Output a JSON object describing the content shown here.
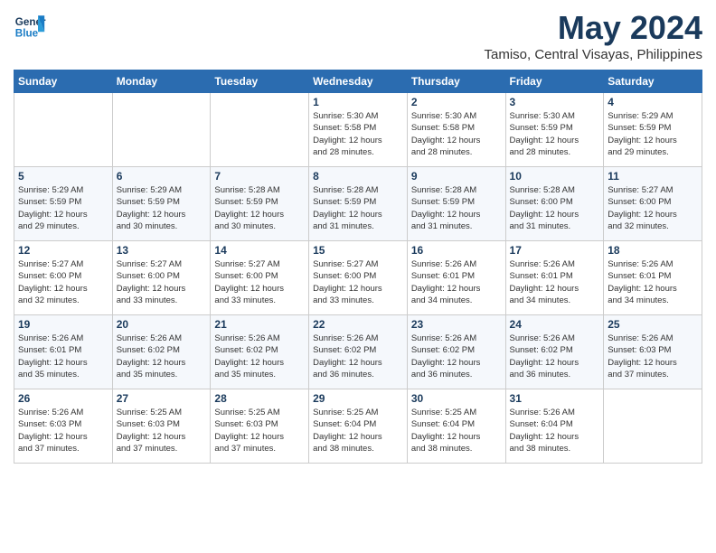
{
  "header": {
    "logo_line1": "General",
    "logo_line2": "Blue",
    "month_title": "May 2024",
    "location": "Tamiso, Central Visayas, Philippines"
  },
  "days_of_week": [
    "Sunday",
    "Monday",
    "Tuesday",
    "Wednesday",
    "Thursday",
    "Friday",
    "Saturday"
  ],
  "weeks": [
    [
      {
        "day": "",
        "info": ""
      },
      {
        "day": "",
        "info": ""
      },
      {
        "day": "",
        "info": ""
      },
      {
        "day": "1",
        "info": "Sunrise: 5:30 AM\nSunset: 5:58 PM\nDaylight: 12 hours\nand 28 minutes."
      },
      {
        "day": "2",
        "info": "Sunrise: 5:30 AM\nSunset: 5:58 PM\nDaylight: 12 hours\nand 28 minutes."
      },
      {
        "day": "3",
        "info": "Sunrise: 5:30 AM\nSunset: 5:59 PM\nDaylight: 12 hours\nand 28 minutes."
      },
      {
        "day": "4",
        "info": "Sunrise: 5:29 AM\nSunset: 5:59 PM\nDaylight: 12 hours\nand 29 minutes."
      }
    ],
    [
      {
        "day": "5",
        "info": "Sunrise: 5:29 AM\nSunset: 5:59 PM\nDaylight: 12 hours\nand 29 minutes."
      },
      {
        "day": "6",
        "info": "Sunrise: 5:29 AM\nSunset: 5:59 PM\nDaylight: 12 hours\nand 30 minutes."
      },
      {
        "day": "7",
        "info": "Sunrise: 5:28 AM\nSunset: 5:59 PM\nDaylight: 12 hours\nand 30 minutes."
      },
      {
        "day": "8",
        "info": "Sunrise: 5:28 AM\nSunset: 5:59 PM\nDaylight: 12 hours\nand 31 minutes."
      },
      {
        "day": "9",
        "info": "Sunrise: 5:28 AM\nSunset: 5:59 PM\nDaylight: 12 hours\nand 31 minutes."
      },
      {
        "day": "10",
        "info": "Sunrise: 5:28 AM\nSunset: 6:00 PM\nDaylight: 12 hours\nand 31 minutes."
      },
      {
        "day": "11",
        "info": "Sunrise: 5:27 AM\nSunset: 6:00 PM\nDaylight: 12 hours\nand 32 minutes."
      }
    ],
    [
      {
        "day": "12",
        "info": "Sunrise: 5:27 AM\nSunset: 6:00 PM\nDaylight: 12 hours\nand 32 minutes."
      },
      {
        "day": "13",
        "info": "Sunrise: 5:27 AM\nSunset: 6:00 PM\nDaylight: 12 hours\nand 33 minutes."
      },
      {
        "day": "14",
        "info": "Sunrise: 5:27 AM\nSunset: 6:00 PM\nDaylight: 12 hours\nand 33 minutes."
      },
      {
        "day": "15",
        "info": "Sunrise: 5:27 AM\nSunset: 6:00 PM\nDaylight: 12 hours\nand 33 minutes."
      },
      {
        "day": "16",
        "info": "Sunrise: 5:26 AM\nSunset: 6:01 PM\nDaylight: 12 hours\nand 34 minutes."
      },
      {
        "day": "17",
        "info": "Sunrise: 5:26 AM\nSunset: 6:01 PM\nDaylight: 12 hours\nand 34 minutes."
      },
      {
        "day": "18",
        "info": "Sunrise: 5:26 AM\nSunset: 6:01 PM\nDaylight: 12 hours\nand 34 minutes."
      }
    ],
    [
      {
        "day": "19",
        "info": "Sunrise: 5:26 AM\nSunset: 6:01 PM\nDaylight: 12 hours\nand 35 minutes."
      },
      {
        "day": "20",
        "info": "Sunrise: 5:26 AM\nSunset: 6:02 PM\nDaylight: 12 hours\nand 35 minutes."
      },
      {
        "day": "21",
        "info": "Sunrise: 5:26 AM\nSunset: 6:02 PM\nDaylight: 12 hours\nand 35 minutes."
      },
      {
        "day": "22",
        "info": "Sunrise: 5:26 AM\nSunset: 6:02 PM\nDaylight: 12 hours\nand 36 minutes."
      },
      {
        "day": "23",
        "info": "Sunrise: 5:26 AM\nSunset: 6:02 PM\nDaylight: 12 hours\nand 36 minutes."
      },
      {
        "day": "24",
        "info": "Sunrise: 5:26 AM\nSunset: 6:02 PM\nDaylight: 12 hours\nand 36 minutes."
      },
      {
        "day": "25",
        "info": "Sunrise: 5:26 AM\nSunset: 6:03 PM\nDaylight: 12 hours\nand 37 minutes."
      }
    ],
    [
      {
        "day": "26",
        "info": "Sunrise: 5:26 AM\nSunset: 6:03 PM\nDaylight: 12 hours\nand 37 minutes."
      },
      {
        "day": "27",
        "info": "Sunrise: 5:25 AM\nSunset: 6:03 PM\nDaylight: 12 hours\nand 37 minutes."
      },
      {
        "day": "28",
        "info": "Sunrise: 5:25 AM\nSunset: 6:03 PM\nDaylight: 12 hours\nand 37 minutes."
      },
      {
        "day": "29",
        "info": "Sunrise: 5:25 AM\nSunset: 6:04 PM\nDaylight: 12 hours\nand 38 minutes."
      },
      {
        "day": "30",
        "info": "Sunrise: 5:25 AM\nSunset: 6:04 PM\nDaylight: 12 hours\nand 38 minutes."
      },
      {
        "day": "31",
        "info": "Sunrise: 5:26 AM\nSunset: 6:04 PM\nDaylight: 12 hours\nand 38 minutes."
      },
      {
        "day": "",
        "info": ""
      }
    ]
  ]
}
